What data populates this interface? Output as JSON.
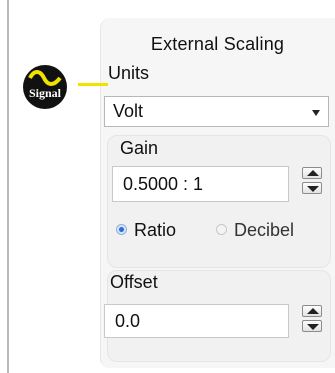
{
  "external_scaling": {
    "title": "External Scaling",
    "units": {
      "label": "Units",
      "selected": "Volt"
    },
    "gain": {
      "label": "Gain",
      "value": "0.5000 : 1",
      "modes": [
        {
          "label": "Ratio",
          "selected": true
        },
        {
          "label": "Decibel",
          "selected": false
        }
      ]
    },
    "offset": {
      "label": "Offset",
      "value": "0.0"
    }
  },
  "signal_icon": {
    "text": "Signal",
    "name": "signal-icon",
    "line_color": "#f1e200"
  },
  "colors": {
    "accent": "#2b6fd6",
    "panel": "#f6f6f6"
  }
}
